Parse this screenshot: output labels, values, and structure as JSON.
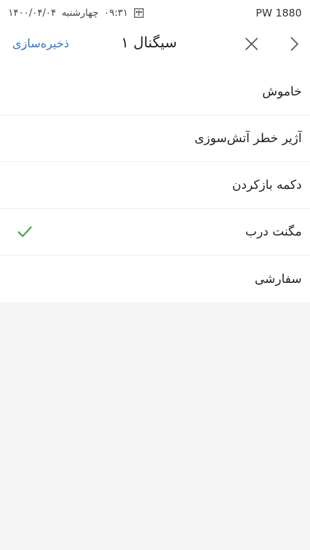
{
  "status_bar": {
    "date": "۱۴۰۰/۰۴/۰۴",
    "day": "چهارشنبه",
    "time": "۰۹:۳۱",
    "device": "PW 1880"
  },
  "header": {
    "title": "سیگنال ۱",
    "save_label": "ذخیره‌سازی"
  },
  "options": [
    {
      "label": "خاموش",
      "selected": false
    },
    {
      "label": "آژیر خطر آتش‌سوزی",
      "selected": false
    },
    {
      "label": "دکمه بازکردن",
      "selected": false
    },
    {
      "label": "مگنت درب",
      "selected": true
    },
    {
      "label": "سفارشی",
      "selected": false
    }
  ],
  "colors": {
    "accent": "#2f74d0",
    "check": "#4caf50",
    "background": "#f5f5f5"
  }
}
